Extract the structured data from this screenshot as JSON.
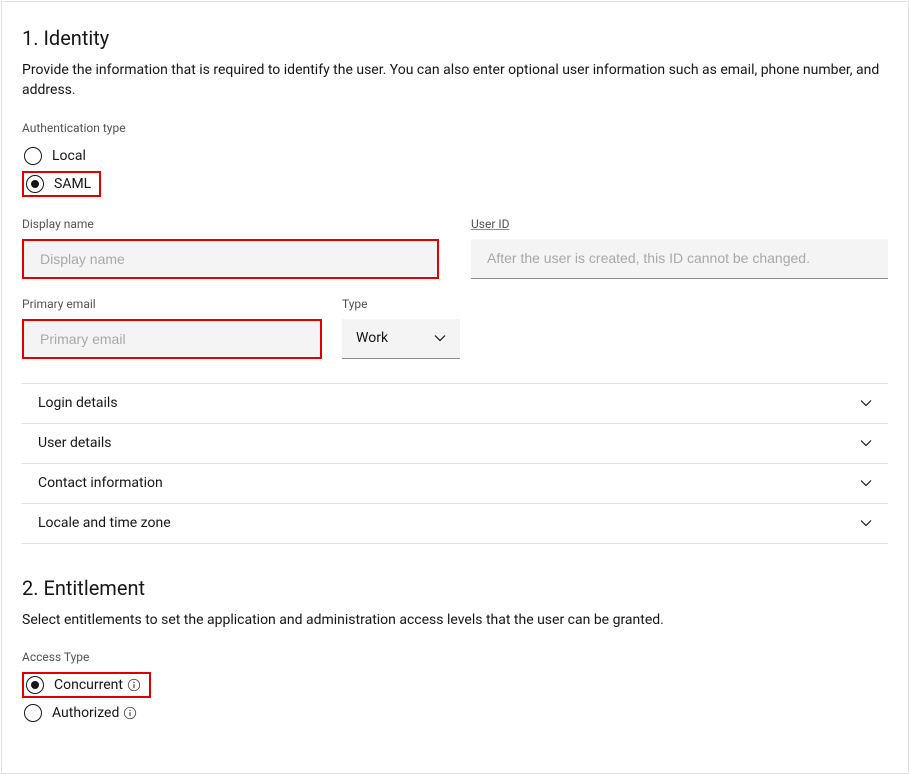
{
  "identity": {
    "title": "1. Identity",
    "description": "Provide the information that is required to identify the user. You can also enter optional user information such as email, phone number, and address.",
    "authTypeLabel": "Authentication type",
    "authOptions": {
      "local": "Local",
      "saml": "SAML"
    },
    "authSelected": "saml",
    "displayName": {
      "label": "Display name",
      "placeholder": "Display name",
      "value": ""
    },
    "userId": {
      "label": "User ID",
      "placeholder": "After the user is created, this ID cannot be changed.",
      "value": ""
    },
    "primaryEmail": {
      "label": "Primary email",
      "placeholder": "Primary email",
      "value": ""
    },
    "emailType": {
      "label": "Type",
      "selected": "Work"
    },
    "accordion": [
      "Login details",
      "User details",
      "Contact information",
      "Locale and time zone"
    ]
  },
  "entitlement": {
    "title": "2. Entitlement",
    "description": "Select entitlements to set the application and administration access levels that the user can be granted.",
    "accessTypeLabel": "Access Type",
    "accessOptions": {
      "concurrent": "Concurrent",
      "authorized": "Authorized"
    },
    "accessSelected": "concurrent"
  }
}
